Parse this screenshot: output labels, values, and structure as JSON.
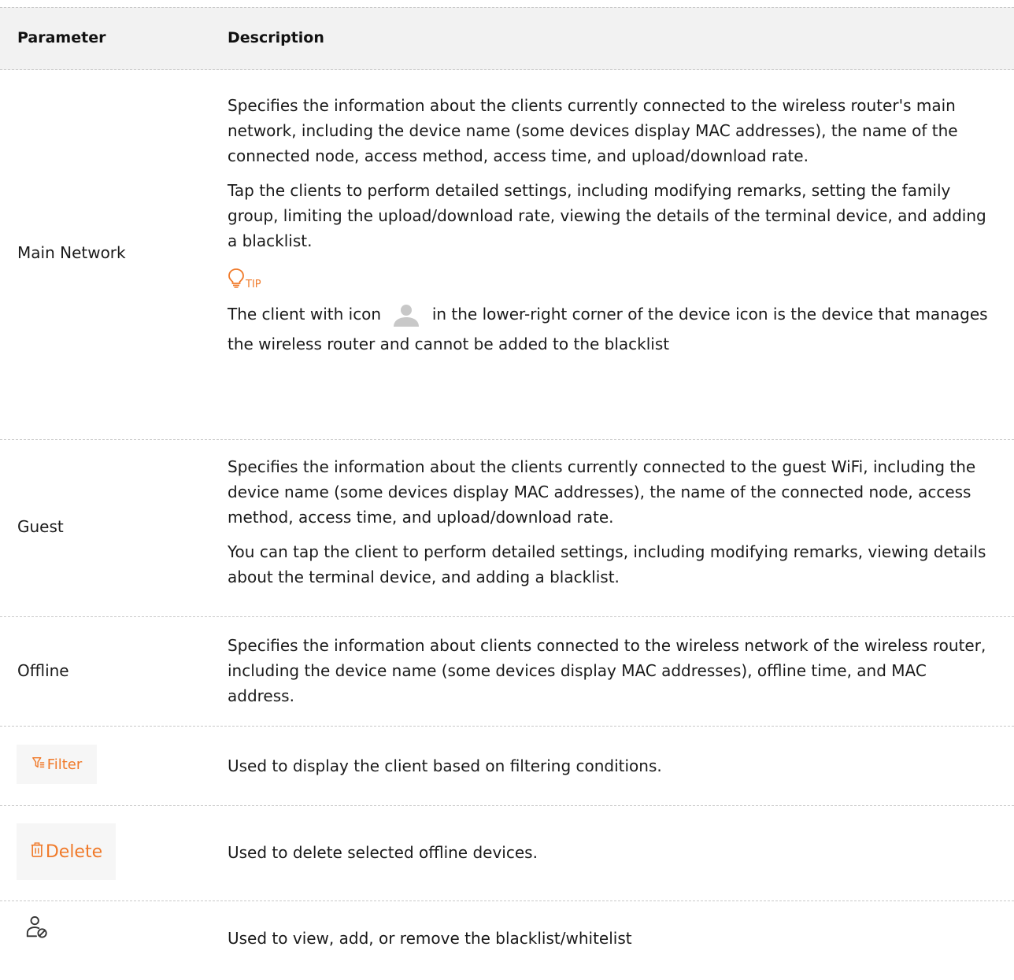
{
  "header": {
    "col1": "Parameter",
    "col2": "Description"
  },
  "rows": {
    "main_network": {
      "label": "Main Network",
      "p1": "Specifies the information about the clients currently connected to the wireless router's main network, including the device name (some devices display MAC addresses), the name of the connected node, access method, access time, and upload/download rate.",
      "p2": "Tap the clients to perform detailed settings, including modifying remarks, setting the family group, limiting the upload/download rate, viewing the details of the terminal device, and adding a blacklist.",
      "tip_label": "TIP",
      "tip_before": "The client with icon",
      "tip_after": "in the lower-right corner of the device icon is the device that manages the wireless router and cannot be added to the blacklist"
    },
    "guest": {
      "label": "Guest",
      "p1": "Specifies the information about the clients currently connected to the guest WiFi, including the device name (some devices display MAC addresses), the name of the connected node, access method, access time, and upload/download rate.",
      "p2": "You can tap the client to perform detailed settings, including modifying remarks, viewing details about the terminal device, and adding a blacklist."
    },
    "offline": {
      "label": "Offline",
      "p1": "Specifies the information about clients connected to the wireless network of the wireless router, including the device name (some devices display MAC addresses), offline time, and MAC address."
    },
    "filter": {
      "button_label": "Filter",
      "desc": "Used to display the client based on filtering conditions."
    },
    "delete": {
      "button_label": "Delete",
      "desc": "Used to delete selected offline devices."
    },
    "blacklist": {
      "desc": "Used to view, add, or remove the blacklist/whitelist"
    }
  },
  "icons": {
    "tip": "lightbulb-icon",
    "manager": "person-icon",
    "filter": "filter-icon",
    "delete": "trash-icon",
    "blacklist": "user-block-icon"
  },
  "colors": {
    "accent": "#f07a2a",
    "header_bg": "#f2f2f2",
    "icon_gray": "#c8c8c8"
  }
}
